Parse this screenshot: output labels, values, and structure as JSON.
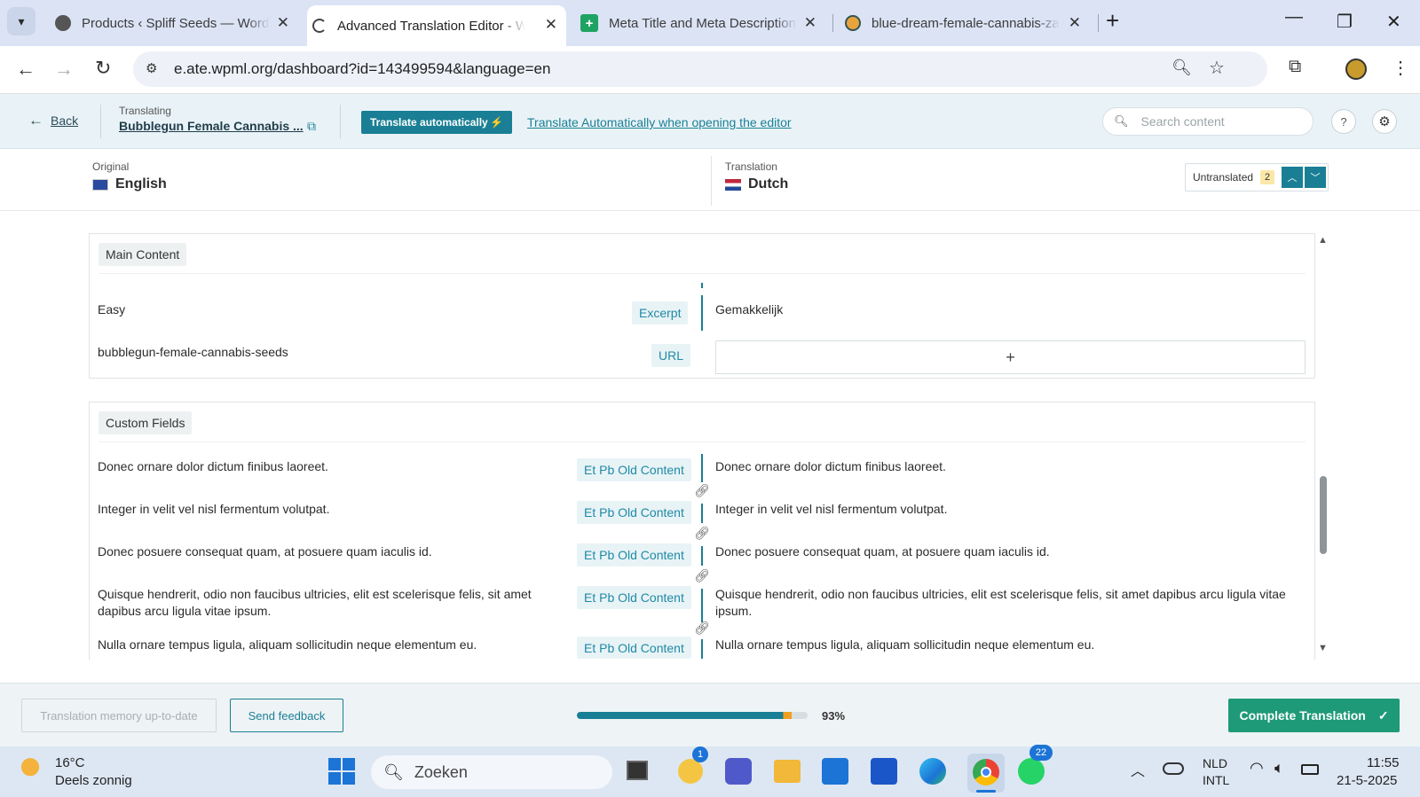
{
  "browser": {
    "tabs": [
      {
        "title": "Products ‹ Spliff Seeds — WordPress"
      },
      {
        "title": "Advanced Translation Editor - WPML"
      },
      {
        "title": "Meta Title and Meta Description"
      },
      {
        "title": "blue-dream-female-cannabis-zaden"
      }
    ],
    "url": "e.ate.wpml.org/dashboard?id=143499594&language=en"
  },
  "header": {
    "back_label": "Back",
    "translating_label": "Translating",
    "document_title": "Bubblegun Female Cannabis ...",
    "translate_auto_button": "Translate automatically",
    "translate_auto_link": "Translate Automatically when opening the editor",
    "search_placeholder": "Search content"
  },
  "languages": {
    "original_label": "Original",
    "original_lang": "English",
    "translation_label": "Translation",
    "translation_lang": "Dutch",
    "untranslated_label": "Untranslated",
    "untranslated_count": "2"
  },
  "main_content": {
    "title": "Main Content",
    "rows": [
      {
        "source": "Easy",
        "tag": "Excerpt",
        "target": "Gemakkelijk"
      },
      {
        "source": "bubblegun-female-cannabis-seeds",
        "tag": "URL",
        "target": "+"
      }
    ]
  },
  "custom_fields": {
    "title": "Custom Fields",
    "rows": [
      {
        "source": "Donec ornare dolor dictum finibus laoreet.",
        "tag": "Et Pb Old Content",
        "target": "Donec ornare dolor dictum finibus laoreet."
      },
      {
        "source": "Integer in velit vel nisl fermentum volutpat.",
        "tag": "Et Pb Old Content",
        "target": "Integer in velit vel nisl fermentum volutpat."
      },
      {
        "source": "Donec posuere consequat quam, at posuere quam iaculis id.",
        "tag": "Et Pb Old Content",
        "target": "Donec posuere consequat quam, at posuere quam iaculis id."
      },
      {
        "source": "Quisque hendrerit, odio non faucibus ultricies, elit est scelerisque felis, sit amet dapibus arcu ligula vitae ipsum.",
        "tag": "Et Pb Old Content",
        "target": "Quisque hendrerit, odio non faucibus ultricies, elit est scelerisque felis, sit amet dapibus arcu ligula vitae ipsum."
      },
      {
        "source": "Nulla ornare tempus ligula, aliquam sollicitudin neque elementum eu.",
        "tag": "Et Pb Old Content",
        "target": "Nulla ornare tempus ligula, aliquam sollicitudin neque elementum eu."
      }
    ]
  },
  "footer": {
    "memory_button": "Translation memory up-to-date",
    "feedback_button": "Send feedback",
    "progress_value": 0.93,
    "progress_label": "93%",
    "complete_button": "Complete Translation"
  },
  "taskbar": {
    "temperature": "16°C",
    "weather": "Deels zonnig",
    "search_placeholder": "Zoeken",
    "notification_badge": "1",
    "whatsapp_badge": "22",
    "lang_line1": "NLD",
    "lang_line2": "INTL",
    "time": "11:55",
    "date": "21-5-2025"
  },
  "colors": {
    "accent": "#1a7f95",
    "complete_button": "#1f9a78",
    "progress_fill": "#1a7f95",
    "progress_end": "#f0a020"
  }
}
